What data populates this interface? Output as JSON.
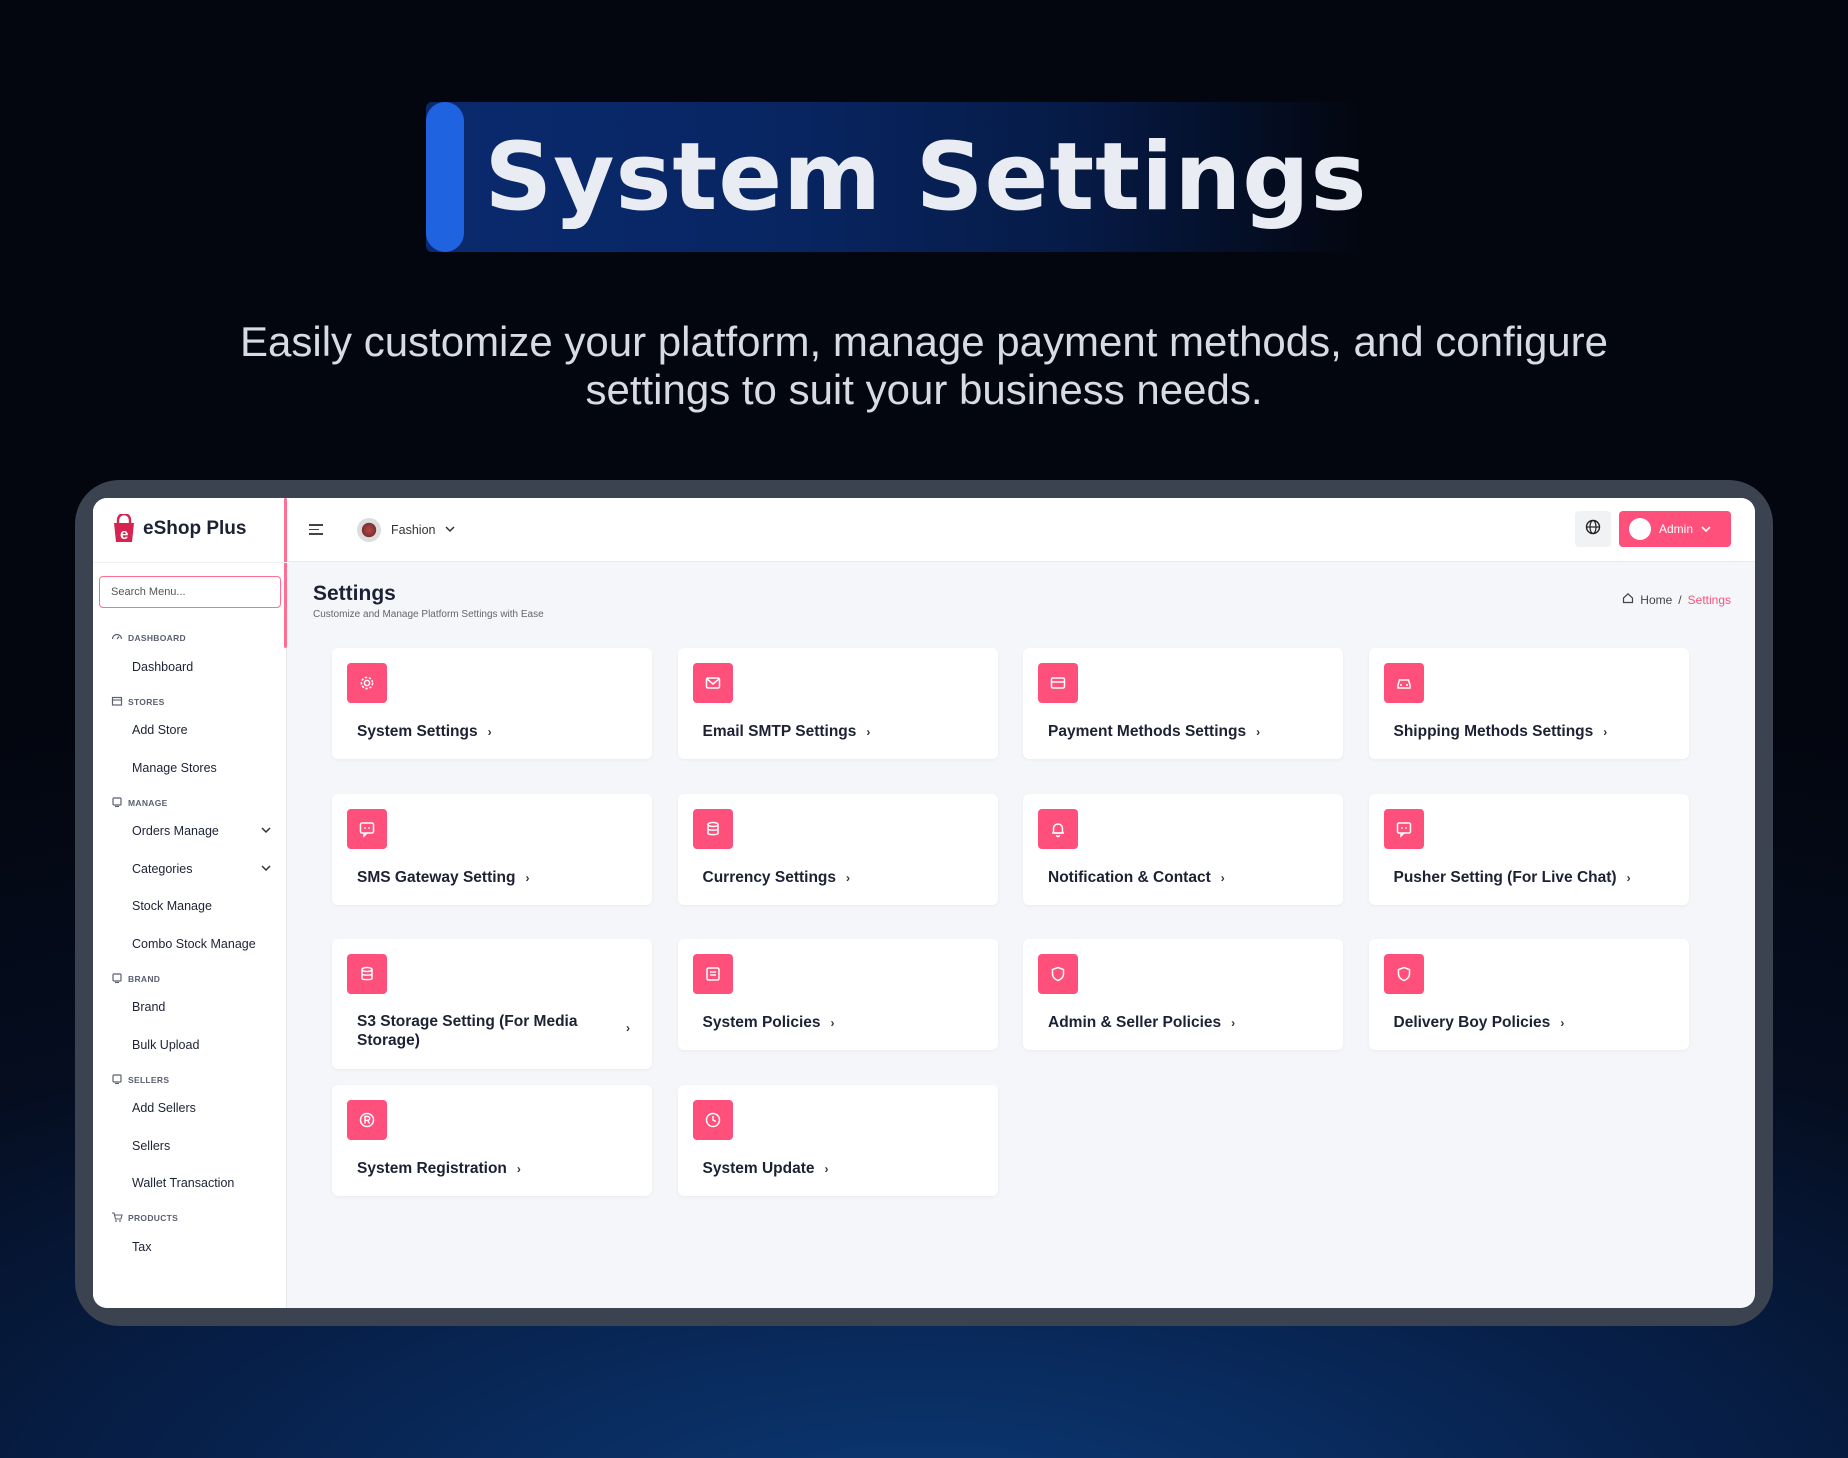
{
  "hero": {
    "title": "System Settings",
    "subtitle_line1": "Easily customize your platform, manage payment methods, and configure",
    "subtitle_line2": "settings to suit your business needs."
  },
  "app": {
    "brand": "eShop Plus",
    "search_placeholder": "Search Menu...",
    "store_name": "Fashion",
    "admin_label": "Admin",
    "accent_color": "#ff4f7b"
  },
  "sidebar": {
    "sections": [
      {
        "label": "DASHBOARD",
        "icon": "gauge-icon",
        "items": [
          {
            "label": "Dashboard"
          }
        ]
      },
      {
        "label": "STORES",
        "icon": "store-icon",
        "items": [
          {
            "label": "Add Store"
          },
          {
            "label": "Manage Stores"
          }
        ]
      },
      {
        "label": "MANAGE",
        "icon": "square-icon",
        "items": [
          {
            "label": "Orders Manage",
            "expandable": true
          },
          {
            "label": "Categories",
            "expandable": true
          },
          {
            "label": "Stock Manage"
          },
          {
            "label": "Combo Stock Manage"
          }
        ]
      },
      {
        "label": "BRAND",
        "icon": "square-icon",
        "items": [
          {
            "label": "Brand"
          },
          {
            "label": "Bulk Upload"
          }
        ]
      },
      {
        "label": "SELLERS",
        "icon": "square-icon",
        "items": [
          {
            "label": "Add Sellers"
          },
          {
            "label": "Sellers"
          },
          {
            "label": "Wallet Transaction"
          }
        ]
      },
      {
        "label": "PRODUCTS",
        "icon": "cart-icon",
        "items": [
          {
            "label": "Tax"
          }
        ]
      }
    ]
  },
  "page": {
    "title": "Settings",
    "subtitle": "Customize and Manage Platform Settings with Ease",
    "breadcrumb_home": "Home",
    "breadcrumb_sep": "/",
    "breadcrumb_current": "Settings"
  },
  "cards": [
    {
      "label": "System Settings",
      "icon": "gear-icon"
    },
    {
      "label": "Email SMTP Settings",
      "icon": "mail-icon"
    },
    {
      "label": "Payment Methods Settings",
      "icon": "credit-card-icon"
    },
    {
      "label": "Shipping Methods Settings",
      "icon": "car-icon"
    },
    {
      "label": "SMS Gateway Setting",
      "icon": "message-icon"
    },
    {
      "label": "Currency Settings",
      "icon": "database-icon"
    },
    {
      "label": "Notification & Contact",
      "icon": "bell-icon"
    },
    {
      "label": "Pusher Setting (For Live Chat)",
      "icon": "message-icon"
    },
    {
      "label": "S3 Storage Setting (For Media Storage)",
      "icon": "database-icon"
    },
    {
      "label": "System Policies",
      "icon": "document-icon"
    },
    {
      "label": "Admin & Seller Policies",
      "icon": "shield-icon"
    },
    {
      "label": "Delivery Boy Policies",
      "icon": "shield-icon"
    },
    {
      "label": "System Registration",
      "icon": "registered-icon"
    },
    {
      "label": "System Update",
      "icon": "clock-icon"
    }
  ],
  "arrow_glyph": "›"
}
